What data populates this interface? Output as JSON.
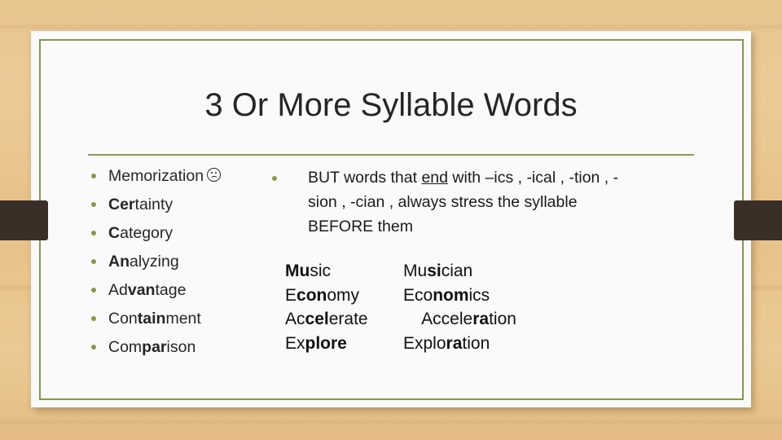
{
  "slide": {
    "title": "3 Or More Syllable Words",
    "left_list": [
      {
        "parts": [
          {
            "t": "Memorization",
            "b": false
          }
        ],
        "icon": "frown-face-icon"
      },
      {
        "parts": [
          {
            "t": "Cer",
            "b": true
          },
          {
            "t": "tainty",
            "b": false
          }
        ]
      },
      {
        "parts": [
          {
            "t": "C",
            "b": true
          },
          {
            "t": "ategory",
            "b": false
          }
        ]
      },
      {
        "parts": [
          {
            "t": "An",
            "b": true
          },
          {
            "t": "alyzing",
            "b": false
          }
        ]
      },
      {
        "parts": [
          {
            "t": "Ad",
            "b": false
          },
          {
            "t": "van",
            "b": true
          },
          {
            "t": "tage",
            "b": false
          }
        ]
      },
      {
        "parts": [
          {
            "t": "Con",
            "b": false
          },
          {
            "t": "tain",
            "b": true
          },
          {
            "t": "ment",
            "b": false
          }
        ]
      },
      {
        "parts": [
          {
            "t": "Com",
            "b": false
          },
          {
            "t": "par",
            "b": true
          },
          {
            "t": "ison",
            "b": false
          }
        ]
      }
    ],
    "rule": {
      "before": "BUT words that ",
      "underlined": "end",
      "after_line1": " with –ics , -ical , -tion , -",
      "line2": "sion , -cian , always stress the syllable",
      "line3": "BEFORE them"
    },
    "column1": [
      {
        "parts": [
          {
            "t": "Mu",
            "b": true
          },
          {
            "t": "sic",
            "b": false
          }
        ]
      },
      {
        "parts": [
          {
            "t": "E",
            "b": false
          },
          {
            "t": "con",
            "b": true
          },
          {
            "t": "omy",
            "b": false
          }
        ]
      },
      {
        "parts": [
          {
            "t": "Ac",
            "b": false
          },
          {
            "t": "cel",
            "b": true
          },
          {
            "t": "erate",
            "b": false
          }
        ]
      },
      {
        "parts": [
          {
            "t": "Ex",
            "b": false
          },
          {
            "t": "plore",
            "b": true
          }
        ]
      }
    ],
    "column2": [
      {
        "parts": [
          {
            "t": "Mu",
            "b": false
          },
          {
            "t": "si",
            "b": true
          },
          {
            "t": "cian",
            "b": false
          }
        ]
      },
      {
        "parts": [
          {
            "t": "Eco",
            "b": false
          },
          {
            "t": "nom",
            "b": true
          },
          {
            "t": "ics",
            "b": false
          }
        ]
      },
      {
        "parts": [
          {
            "t": "    Accele",
            "b": false
          },
          {
            "t": "ra",
            "b": true
          },
          {
            "t": "tion",
            "b": false
          }
        ]
      },
      {
        "parts": [
          {
            "t": "Explo",
            "b": false
          },
          {
            "t": "ra",
            "b": true
          },
          {
            "t": "tion",
            "b": false
          }
        ]
      }
    ],
    "colors": {
      "accent": "#87964e",
      "tab": "#3a2f27",
      "text": "#262626"
    }
  }
}
